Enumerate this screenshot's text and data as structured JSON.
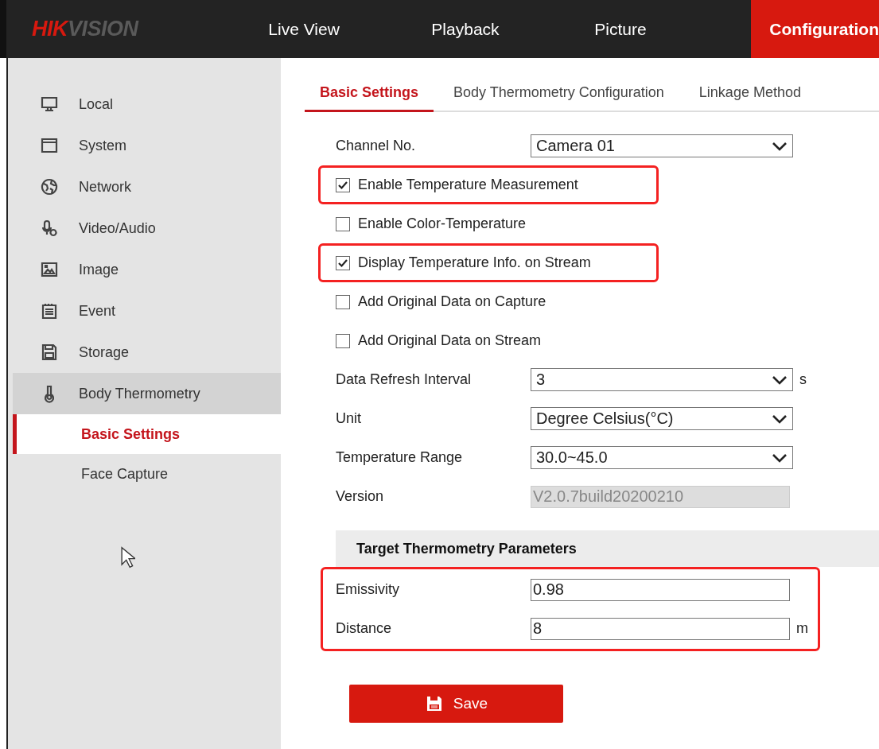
{
  "header": {
    "logo_prefix": "HIK",
    "logo_suffix": "VISION",
    "nav": [
      {
        "label": "Live View",
        "selected": false
      },
      {
        "label": "Playback",
        "selected": false
      },
      {
        "label": "Picture",
        "selected": false
      },
      {
        "label": "Configuration",
        "selected": true
      }
    ]
  },
  "sidebar": {
    "items": [
      {
        "label": "Local",
        "selected": false
      },
      {
        "label": "System",
        "selected": false
      },
      {
        "label": "Network",
        "selected": false
      },
      {
        "label": "Video/Audio",
        "selected": false
      },
      {
        "label": "Image",
        "selected": false
      },
      {
        "label": "Event",
        "selected": false
      },
      {
        "label": "Storage",
        "selected": false
      },
      {
        "label": "Body Thermometry",
        "selected": true,
        "children": [
          {
            "label": "Basic Settings",
            "selected": true
          },
          {
            "label": "Face Capture",
            "selected": false
          }
        ]
      }
    ]
  },
  "tabs": [
    {
      "label": "Basic Settings",
      "selected": true
    },
    {
      "label": "Body Thermometry Configuration",
      "selected": false
    },
    {
      "label": "Linkage Method",
      "selected": false
    }
  ],
  "fields": [
    {
      "kind": "select",
      "label": "Channel No.",
      "value": "Camera 01"
    },
    {
      "kind": "checkbox",
      "label": "Enable Temperature Measurement",
      "checked": true,
      "highlighted": true
    },
    {
      "kind": "checkbox",
      "label": "Enable Color-Temperature",
      "checked": false,
      "highlighted": false
    },
    {
      "kind": "checkbox",
      "label": "Display Temperature Info. on Stream",
      "checked": true,
      "highlighted": true
    },
    {
      "kind": "checkbox",
      "label": "Add Original Data on Capture",
      "checked": false,
      "highlighted": false
    },
    {
      "kind": "checkbox",
      "label": "Add Original Data on Stream",
      "checked": false,
      "highlighted": false
    },
    {
      "kind": "select",
      "label": "Data Refresh Interval",
      "value": "3",
      "unit": "s"
    },
    {
      "kind": "select",
      "label": "Unit",
      "value": "Degree Celsius(°C)"
    },
    {
      "kind": "select",
      "label": "Temperature Range",
      "value": "30.0~45.0"
    },
    {
      "kind": "readonly",
      "label": "Version",
      "value": "V2.0.7build20200210",
      "disabled": true
    }
  ],
  "target_params": {
    "title": "Target Thermometry Parameters",
    "highlighted": true,
    "fields": [
      {
        "kind": "text",
        "label": "Emissivity",
        "value": "0.98"
      },
      {
        "kind": "text",
        "label": "Distance",
        "value": "8",
        "unit": "m"
      }
    ]
  },
  "save_button": "Save"
}
